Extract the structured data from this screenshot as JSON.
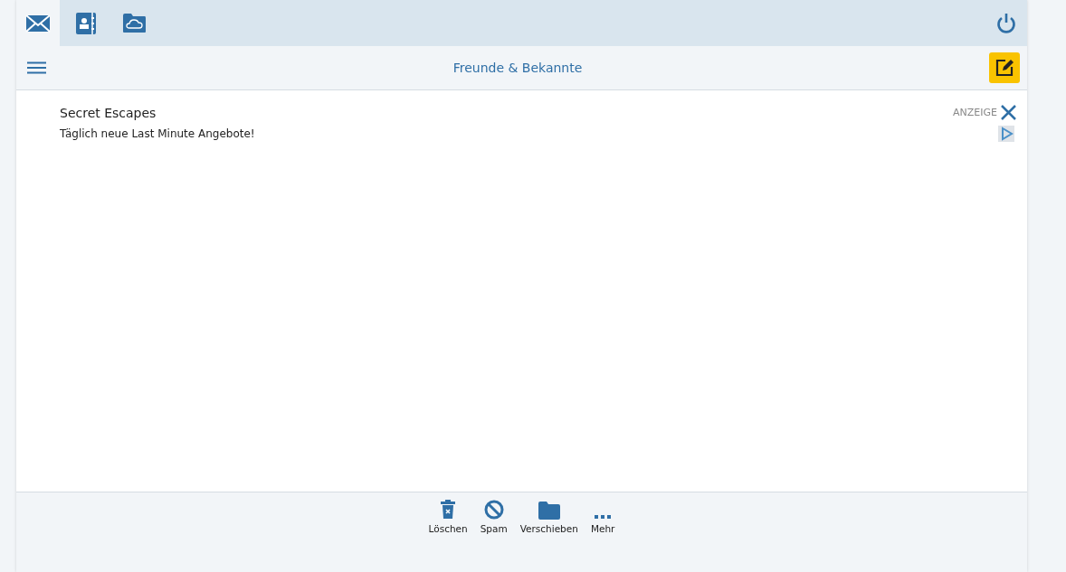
{
  "tabs": [
    {
      "kind": "mail",
      "selected": true
    },
    {
      "kind": "contacts",
      "selected": false
    },
    {
      "kind": "cloud",
      "selected": false
    }
  ],
  "header": {
    "title": "Freunde & Bekannte"
  },
  "ad": {
    "title": "Secret Escapes",
    "text": "Täglich neue Last Minute Angebote!",
    "label": "ANZEIGE"
  },
  "actions": [
    {
      "kind": "delete",
      "label": "Löschen"
    },
    {
      "kind": "spam",
      "label": "Spam"
    },
    {
      "kind": "move",
      "label": "Verschieben"
    },
    {
      "kind": "more",
      "label": "Mehr"
    }
  ]
}
